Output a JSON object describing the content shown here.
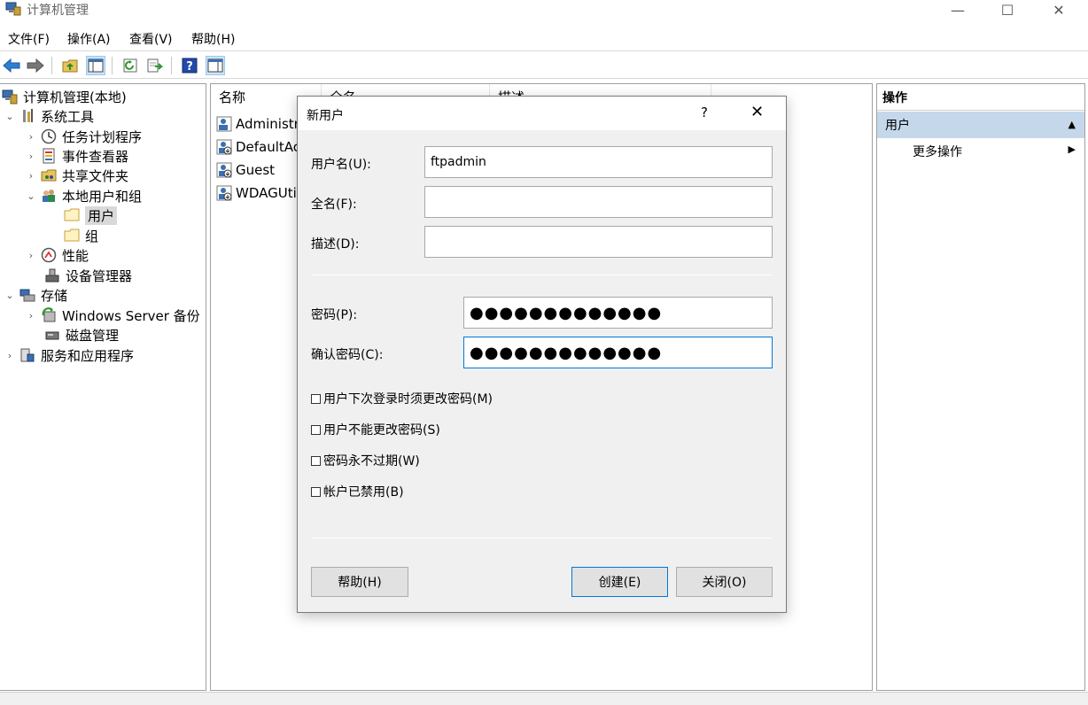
{
  "window": {
    "title": "计算机管理",
    "controls": {
      "minimize": "—",
      "maximize": "☐",
      "close": "✕"
    }
  },
  "menu": [
    "文件(F)",
    "操作(A)",
    "查看(V)",
    "帮助(H)"
  ],
  "toolbar": {
    "icons": [
      "back-icon",
      "forward-icon",
      "up-folder-icon",
      "show-hide-tree-icon",
      "refresh-icon",
      "export-list-icon",
      "help-icon",
      "show-hide-action-pane-icon"
    ]
  },
  "tree": {
    "root": "计算机管理(本地)",
    "system_tools": "系统工具",
    "task_scheduler": "任务计划程序",
    "event_viewer": "事件查看器",
    "shared_folders": "共享文件夹",
    "local_users_groups": "本地用户和组",
    "users": "用户",
    "groups": "组",
    "performance": "性能",
    "device_manager": "设备管理器",
    "storage": "存储",
    "windows_server_backup": "Windows Server 备份",
    "disk_management": "磁盘管理",
    "services_apps": "服务和应用程序"
  },
  "list": {
    "columns": [
      "名称",
      "全名",
      "描述"
    ],
    "rows": [
      "Administrator",
      "DefaultAccount",
      "Guest",
      "WDAGUtilityAccount"
    ]
  },
  "actions": {
    "header": "操作",
    "section": "用户",
    "more": "更多操作"
  },
  "dialog": {
    "title": "新用户",
    "help_glyph": "?",
    "close_glyph": "✕",
    "username_label": "用户名(U):",
    "username_value": "ftpadmin",
    "fullname_label": "全名(F):",
    "fullname_value": "",
    "description_label": "描述(D):",
    "description_value": "",
    "password_label": "密码(P):",
    "password_value": "●●●●●●●●●●●●●",
    "confirm_label": "确认密码(C):",
    "confirm_value": "●●●●●●●●●●●●●",
    "checkboxes": [
      {
        "label": "用户下次登录时须更改密码(M)",
        "checked": false
      },
      {
        "label": "用户不能更改密码(S)",
        "checked": false
      },
      {
        "label": "密码永不过期(W)",
        "checked": false
      },
      {
        "label": "帐户已禁用(B)",
        "checked": false
      }
    ],
    "help_button": "帮助(H)",
    "create_button": "创建(E)",
    "close_button": "关闭(O)"
  }
}
